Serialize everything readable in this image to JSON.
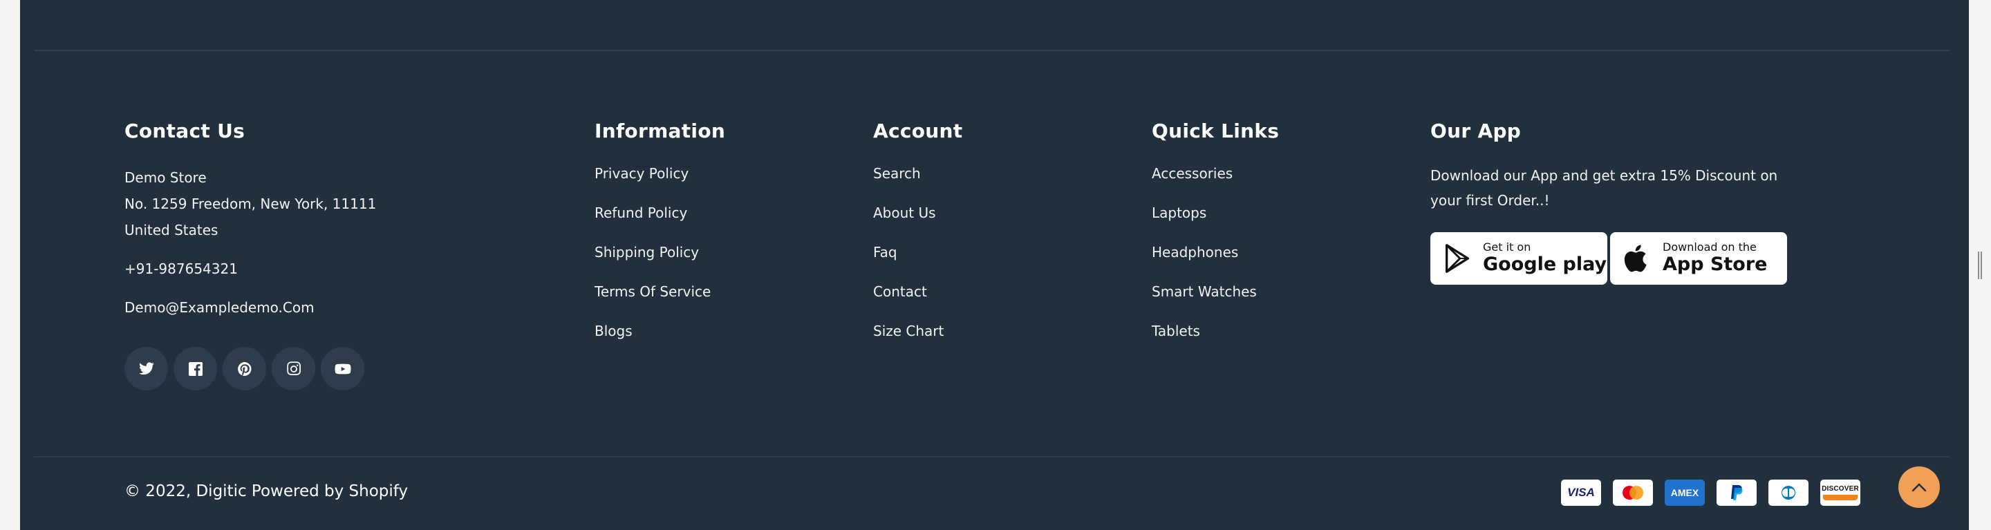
{
  "contact": {
    "heading": "Contact Us",
    "store": "Demo Store",
    "address_line1": "No. 1259 Freedom, New York, 11111",
    "address_line2": "United States",
    "phone": "+91-987654321",
    "email": "Demo@Exampledemo.Com",
    "socials": [
      "twitter-icon",
      "facebook-icon",
      "pinterest-icon",
      "instagram-icon",
      "youtube-icon"
    ]
  },
  "information": {
    "heading": "Information",
    "links": [
      "Privacy Policy",
      "Refund Policy",
      "Shipping Policy",
      "Terms Of Service",
      "Blogs"
    ]
  },
  "account": {
    "heading": "Account",
    "links": [
      "Search",
      "About Us",
      "Faq",
      "Contact",
      "Size Chart"
    ]
  },
  "quick_links": {
    "heading": "Quick Links",
    "links": [
      "Accessories",
      "Laptops",
      "Headphones",
      "Smart Watches",
      "Tablets"
    ]
  },
  "app": {
    "heading": "Our App",
    "text": "Download our App and get extra 15% Discount on your first Order..!",
    "google_small": "Get it on",
    "google_big": "Google play",
    "apple_small": "Download on the",
    "apple_big": "App Store"
  },
  "bottom": {
    "copyright": "© 2022, Digitic Powered by Shopify",
    "payments": [
      "VISA",
      "mastercard",
      "AMEX",
      "PayPal",
      "Diners Club",
      "DISCOVER"
    ]
  },
  "colors": {
    "footer_bg": "#222f3d",
    "accent": "#f2a056"
  }
}
